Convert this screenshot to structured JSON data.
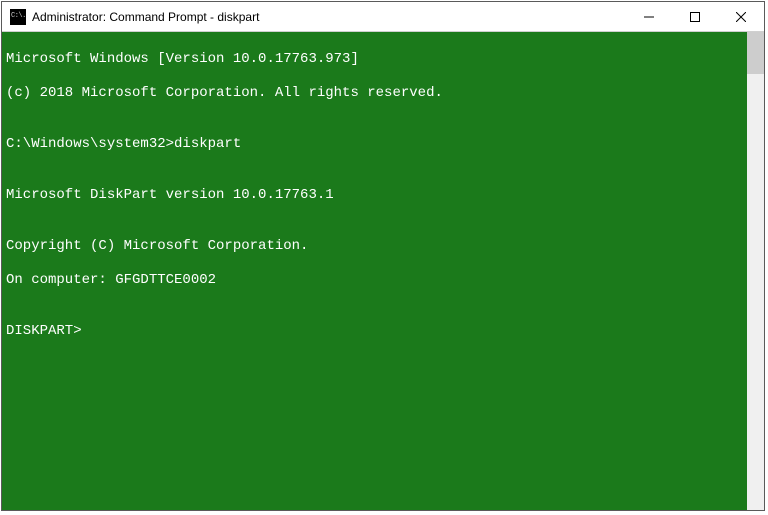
{
  "window": {
    "title": "Administrator: Command Prompt - diskpart",
    "icon_label": "C:\\."
  },
  "console": {
    "bg_color": "#1b7a1b",
    "fg_color": "#ffffff",
    "lines": [
      "Microsoft Windows [Version 10.0.17763.973]",
      "(c) 2018 Microsoft Corporation. All rights reserved.",
      "",
      "C:\\Windows\\system32>diskpart",
      "",
      "Microsoft DiskPart version 10.0.17763.1",
      "",
      "Copyright (C) Microsoft Corporation.",
      "On computer: GFGDTTCE0002",
      "",
      "DISKPART>"
    ],
    "prompt_path": "C:\\Windows\\system32>",
    "command": "diskpart",
    "diskpart_prompt": "DISKPART>"
  }
}
